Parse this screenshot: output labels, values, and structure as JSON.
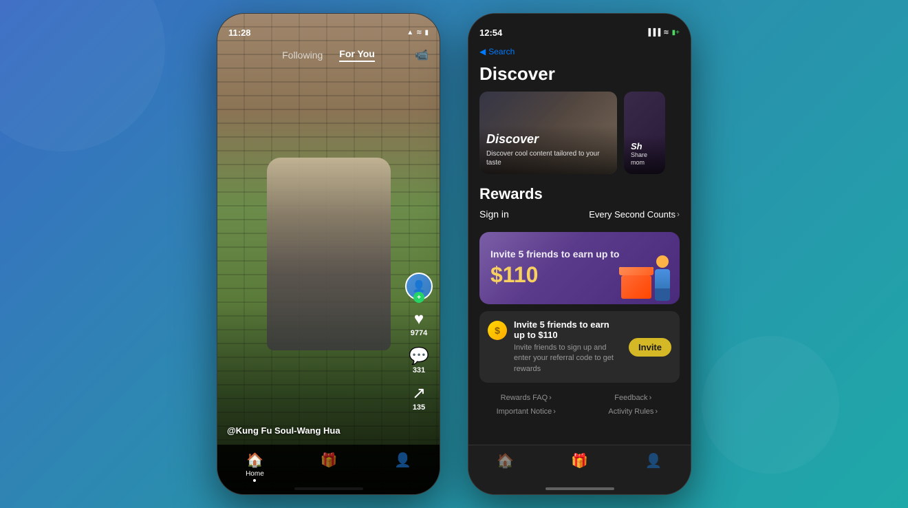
{
  "background": {
    "gradient": "linear-gradient(135deg, #3a6bc4 0%, #2a8fad 50%, #1fa8a8 100%)"
  },
  "leftPhone": {
    "statusBar": {
      "time": "11:28",
      "signal": "▲",
      "wifi": "WiFi",
      "battery": "■"
    },
    "nav": {
      "following": "Following",
      "forYou": "For You",
      "cameraIcon": "📹"
    },
    "video": {
      "username": "@Kung Fu Soul-Wang Hua"
    },
    "actions": {
      "likeCount": "9774",
      "commentCount": "331",
      "shareCount": "135"
    },
    "bottomNav": {
      "items": [
        {
          "label": "Home",
          "active": true
        },
        {
          "label": "🎁",
          "active": false
        },
        {
          "label": "👤",
          "active": false
        }
      ]
    }
  },
  "rightPhone": {
    "statusBar": {
      "time": "12:54",
      "locationIcon": "▲",
      "signal": "|||",
      "wifi": "WiFi",
      "battery": "■"
    },
    "topNav": {
      "backLabel": "◀ Search"
    },
    "discoverSection": {
      "title": "Discover",
      "cards": [
        {
          "title": "Discover",
          "description": "Discover cool content tailored to your taste"
        },
        {
          "title": "Sh",
          "description": "Share mom"
        }
      ]
    },
    "rewardsSection": {
      "title": "Rewards",
      "signInLabel": "Sign in",
      "everySecondCounts": "Every Second Counts",
      "chevron": "›"
    },
    "inviteBanner": {
      "line1": "Invite 5 friends to earn up to",
      "amount": "$110"
    },
    "inviteCard": {
      "title": "Invite 5 friends to earn up to $110",
      "subtitle": "Invite friends to sign up and enter your referral code to get rewards",
      "buttonLabel": "Invite"
    },
    "links": [
      {
        "label": "Rewards FAQ",
        "chevron": "›"
      },
      {
        "label": "Feedback",
        "chevron": "›"
      },
      {
        "label": "Important Notice",
        "chevron": "›"
      },
      {
        "label": "Activity Rules",
        "chevron": "›"
      }
    ],
    "bottomNav": {
      "homeIcon": "🏠",
      "giftIcon": "🎁",
      "profileIcon": "👤"
    }
  }
}
